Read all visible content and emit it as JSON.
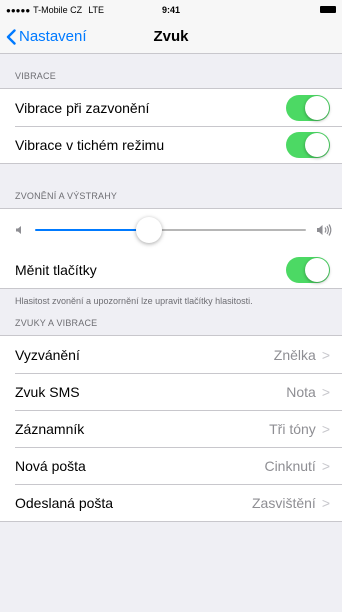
{
  "status_bar": {
    "signal": "●●●●●",
    "carrier": "T-Mobile CZ",
    "network": "LTE",
    "time": "9:41"
  },
  "nav": {
    "back_label": "Nastavení",
    "title": "Zvuk"
  },
  "sections": {
    "vibrace": {
      "header": "VIBRACE",
      "rows": [
        {
          "label": "Vibrace při zazvonění",
          "on": true
        },
        {
          "label": "Vibrace v tichém režimu",
          "on": true
        }
      ]
    },
    "zvoneni": {
      "header": "ZVONĚNÍ A VÝSTRAHY",
      "volume_level": 0.42,
      "toggle_label": "Měnit tlačítky",
      "toggle_on": true,
      "footer": "Hlasitost zvonění a upozornění lze upravit tlačítky hlasitosti."
    },
    "zvuky": {
      "header": "ZVUKY A VIBRACE",
      "rows": [
        {
          "label": "Vyzvánění",
          "value": "Znělka"
        },
        {
          "label": "Zvuk SMS",
          "value": "Nota"
        },
        {
          "label": "Záznamník",
          "value": "Tři tóny"
        },
        {
          "label": "Nová pošta",
          "value": "Cinknutí"
        },
        {
          "label": "Odeslaná pošta",
          "value": "Zasvištění"
        }
      ],
      "chevron": ">"
    }
  },
  "colors": {
    "accent": "#007aff",
    "toggle_on": "#4cd964",
    "background": "#efeff4"
  }
}
